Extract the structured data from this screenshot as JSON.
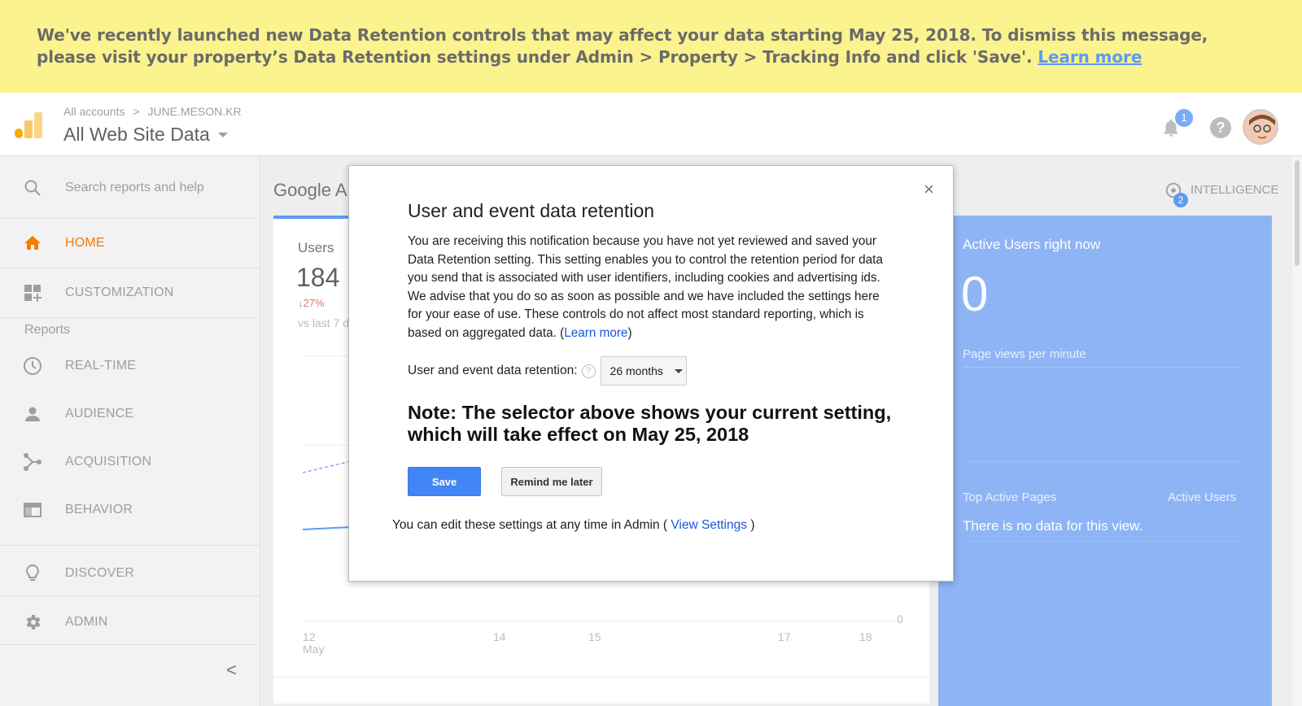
{
  "banner": {
    "text": "We've recently launched new Data Retention controls that may affect your data starting May 25, 2018. To dismiss this message, please visit your property’s Data Retention settings under Admin > Property > Tracking Info and click 'Save'.",
    "link": "Learn more"
  },
  "header": {
    "crumb_root": "All accounts",
    "crumb_sep": ">",
    "crumb_account": "JUNE.MESON.KR",
    "view_title": "All Web Site Data",
    "notification_count": "1",
    "help_glyph": "?"
  },
  "sidebar": {
    "search_placeholder": "Search reports and help",
    "home": "HOME",
    "customization": "CUSTOMIZATION",
    "reports_label": "Reports",
    "realtime": "REAL-TIME",
    "audience": "AUDIENCE",
    "acquisition": "ACQUISITION",
    "behavior": "BEHAVIOR",
    "discover": "DISCOVER",
    "admin": "ADMIN",
    "collapse_glyph": "<"
  },
  "main": {
    "title": "Google A",
    "intelligence": "INTELLIGENCE",
    "intelligence_badge": "2",
    "users_label": "Users",
    "users_value": "184",
    "users_delta": "↓27%",
    "users_vs": "vs last 7 d",
    "zero_label": "0",
    "xticks": [
      "12",
      "May",
      "14",
      "15",
      "17",
      "18"
    ]
  },
  "realtime_panel": {
    "title": "Active Users right now",
    "value": "0",
    "pageviews": "Page views per minute",
    "top_pages": "Top Active Pages",
    "active_users": "Active Users",
    "no_data": "There is no data for this view."
  },
  "modal": {
    "close_glyph": "×",
    "title": "User and event data retention",
    "body": "You are receiving this notification because you have not yet reviewed and saved your Data Retention setting. This setting enables you to control the retention period for data you send that is associated with user identifiers, including cookies and advertising ids. We advise that you do so as soon as possible and we have included the settings here for your ease of use. These controls do not affect most standard reporting, which is based on aggregated data. (",
    "body_link": "Learn more",
    "body_end": ")",
    "retention_label": "User and event data retention:",
    "retention_help": "?",
    "retention_value": "26 months",
    "note": "Note: The selector above shows your current setting, which will take effect on May 25, 2018",
    "save": "Save",
    "remind": "Remind me later",
    "footer_text": "You can edit these settings at any time in Admin (",
    "footer_link": "View Settings",
    "footer_end": ")"
  },
  "colors": {
    "banner_bg": "#fbf38d",
    "accent_orange": "#f57c00",
    "primary_blue": "#4285f4",
    "realtime_blue": "#8fb4f5"
  }
}
